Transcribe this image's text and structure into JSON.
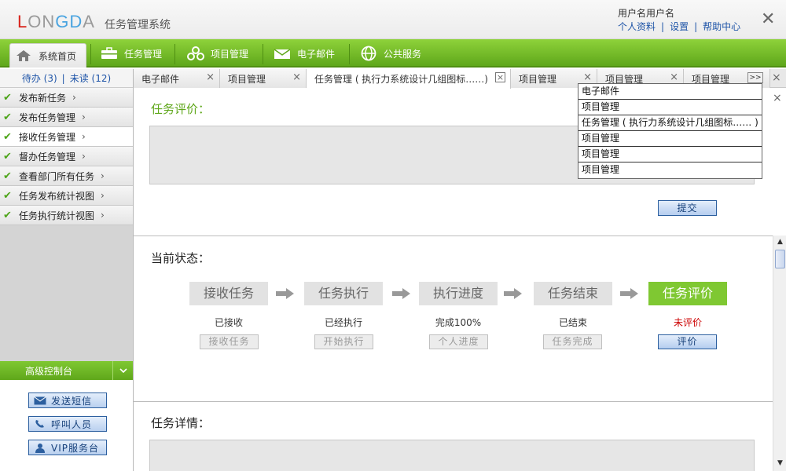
{
  "header": {
    "logo_parts": [
      "L",
      "ON",
      "G",
      "D",
      "A"
    ],
    "system_title": "任务管理系统",
    "username": "用户名用户名",
    "links": [
      "个人资料",
      "设置",
      "帮助中心"
    ],
    "close": "✕"
  },
  "nav": {
    "items": [
      {
        "label": "系统首页",
        "icon": "home-icon"
      },
      {
        "label": "任务管理",
        "icon": "briefcase-icon"
      },
      {
        "label": "项目管理",
        "icon": "project-icon"
      },
      {
        "label": "电子邮件",
        "icon": "mail-icon"
      },
      {
        "label": "公共服务",
        "icon": "globe-icon"
      }
    ]
  },
  "sidebar": {
    "todo": "待办 (3)",
    "unread": "未读 (12)",
    "sep": "|",
    "items": [
      {
        "label": "发布新任务"
      },
      {
        "label": "发布任务管理"
      },
      {
        "label": "接收任务管理"
      },
      {
        "label": "督办任务管理"
      },
      {
        "label": "查看部门所有任务"
      },
      {
        "label": "任务发布统计视图"
      },
      {
        "label": "任务执行统计视图"
      }
    ],
    "chevron": "›",
    "check": "✔",
    "advanced_title": "高级控制台",
    "advanced_buttons": [
      "发送短信",
      "呼叫人员",
      "VIP服务台"
    ]
  },
  "tabs": [
    {
      "label": "电子邮件"
    },
    {
      "label": "项目管理"
    },
    {
      "label": "任务管理 ( 执行力系统设计几组图标……)"
    },
    {
      "label": "项目管理"
    },
    {
      "label": "项目管理"
    },
    {
      "label": "项目管理"
    }
  ],
  "tab_controls": {
    "close": "×",
    "more": ">>"
  },
  "dropdown": [
    "电子邮件",
    "项目管理",
    "任务管理 ( 执行力系统设计几组图标…… )",
    "项目管理",
    "项目管理",
    "项目管理"
  ],
  "evaluation": {
    "title": "任务评价：",
    "submit": "提交"
  },
  "status": {
    "title": "当前状态：",
    "steps": [
      {
        "label": "接收任务",
        "status": "已接收",
        "button": "接收任务"
      },
      {
        "label": "任务执行",
        "status": "已经执行",
        "button": "开始执行"
      },
      {
        "label": "执行进度",
        "status": "完成100%",
        "button": "个人进度"
      },
      {
        "label": "任务结束",
        "status": "已结束",
        "button": "任务完成"
      },
      {
        "label": "任务评价",
        "status": "未评价",
        "button": "评价"
      }
    ]
  },
  "details": {
    "title": "任务详情："
  },
  "colors": {
    "accent": "#6fbb25",
    "link": "#1f55a8",
    "alert": "#cc0000"
  }
}
